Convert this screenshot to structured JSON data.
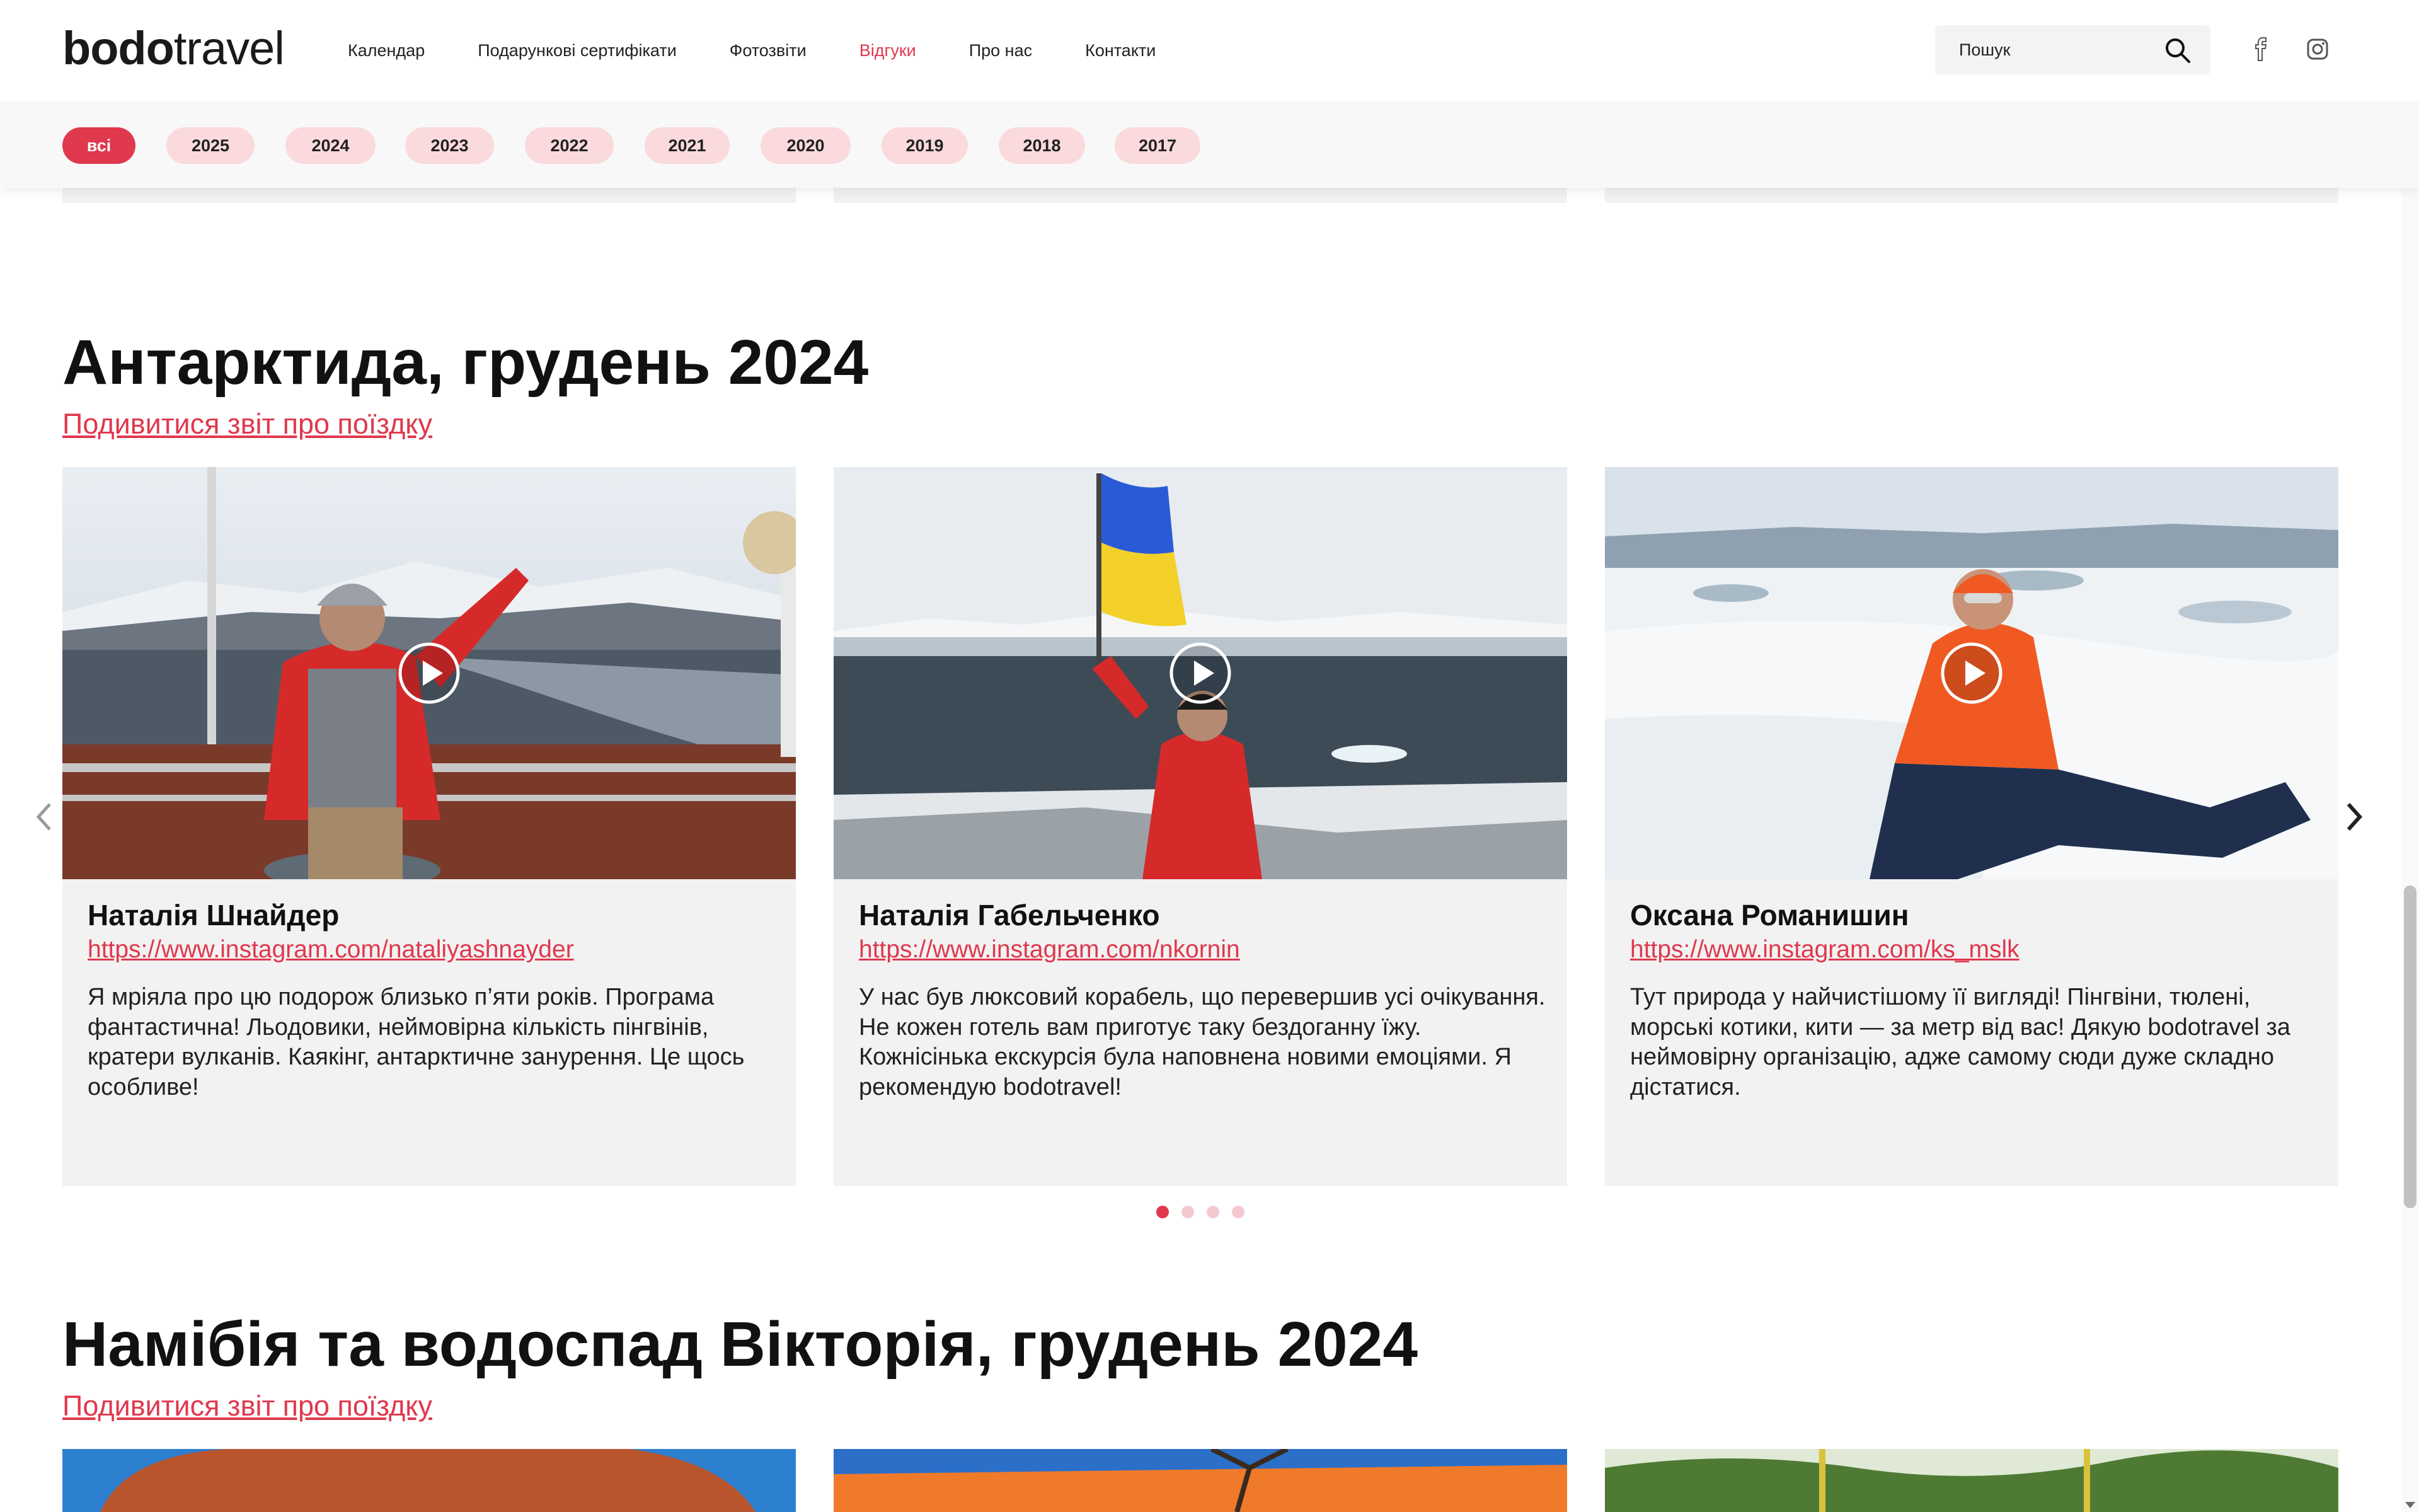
{
  "header": {
    "logo_bold": "bodo",
    "logo_light": "travel",
    "nav": [
      "Календар",
      "Подарункові сертифікати",
      "Фотозвіти",
      "Відгуки",
      "Про нас",
      "Контакти"
    ],
    "active_nav": "Відгуки",
    "search_placeholder": "Пошук"
  },
  "filter": {
    "years": [
      "всі",
      "2025",
      "2024",
      "2023",
      "2022",
      "2021",
      "2020",
      "2019",
      "2018",
      "2017"
    ],
    "active": "всі"
  },
  "sections": [
    {
      "title": "Антарктида, грудень 2024",
      "report_link": "Подивитися звіт про поїздку",
      "cards": [
        {
          "name": "Наталія Шнайдер",
          "link": "https://www.instagram.com/nataliyashnayder",
          "text": "Я мріяла про цю подорож близько п’яти років. Програма фантастична! Льодовики, неймовірна кількість пінгвінів, кратери вулканів. Каякінг, антарктичне занурення. Це щось особливе!"
        },
        {
          "name": "Наталія Габельченко",
          "link": "https://www.instagram.com/nkornin",
          "text": "У нас був люксовий корабель, що перевершив усі очікування. Не кожен готель вам приготує таку бездоганну їжу. Кожнісінька екскурсія була наповнена новими емоціями. Я рекомендую bodotravel!"
        },
        {
          "name": "Оксана Романишин",
          "link": "https://www.instagram.com/ks_mslk",
          "text": "Тут природа у найчистішому її вигляді! Пінгвіни, тюлені, морські котики, кити — за метр від вас! Дякую bodotravel за неймовірну організацію, адже самому сюди дуже складно дістатися."
        }
      ],
      "slider": {
        "pages": 4,
        "current": 1
      }
    },
    {
      "title": "Намібія та водоспад Вікторія, грудень 2024",
      "report_link": "Подивитися звіт про поїздку"
    }
  ],
  "colors": {
    "accent": "#e0384d",
    "pill_bg": "#fadadd",
    "card_bg": "#f2f2f2"
  }
}
